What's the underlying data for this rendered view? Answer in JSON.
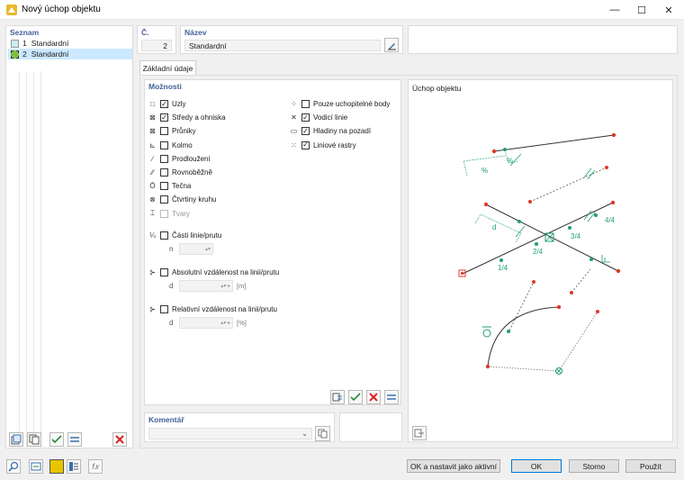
{
  "window": {
    "title": "Nový úchop objektu",
    "minimize": "—",
    "maximize": "☐",
    "close": "✕"
  },
  "list": {
    "title": "Seznam",
    "items": [
      {
        "num": "1",
        "label": "Standardní",
        "color": "#c8ecf0"
      },
      {
        "num": "2",
        "label": "Standardní",
        "color": "#7fbf3f"
      }
    ]
  },
  "number": {
    "label": "Č.",
    "value": "2"
  },
  "name": {
    "label": "Název",
    "value": "Standardní"
  },
  "tabs": [
    "Základní údaje"
  ],
  "options": {
    "title": "Možnosti",
    "left": [
      {
        "label": "Uzly",
        "checked": true,
        "icon": "□"
      },
      {
        "label": "Středy a ohniska",
        "checked": true,
        "icon": "⊠"
      },
      {
        "label": "Průniky",
        "checked": false,
        "icon": "⊠"
      },
      {
        "label": "Kolmo",
        "checked": false,
        "icon": "⊾"
      },
      {
        "label": "Prodloužení",
        "checked": false,
        "icon": "∕"
      },
      {
        "label": "Rovnoběžně",
        "checked": false,
        "icon": "∕∕"
      },
      {
        "label": "Tečna",
        "checked": false,
        "icon": "Ō"
      },
      {
        "label": "Čtvrtiny kruhu",
        "checked": false,
        "icon": "⊗"
      },
      {
        "label": "Tvary",
        "checked": false,
        "icon": "⌶",
        "disabled": true
      }
    ],
    "right": [
      {
        "label": "Pouze uchopitelné body",
        "checked": false,
        "icon": "⁘"
      },
      {
        "label": "Vodicí linie",
        "checked": true,
        "icon": "✕"
      },
      {
        "label": "Hladiny na pozadí",
        "checked": true,
        "icon": "▭"
      },
      {
        "label": "Liniové rastry",
        "checked": true,
        "icon": "⁙"
      }
    ],
    "parts": {
      "label": "Části linie/prutu",
      "checked": false,
      "icon": "¼",
      "field_label": "n"
    },
    "absolute": {
      "label": "Absolutní vzdálenost na linii/prutu",
      "checked": false,
      "icon": "⊱",
      "field_label": "d",
      "unit": "[m]"
    },
    "relative": {
      "label": "Relativní vzdálenost na linii/prutu",
      "checked": false,
      "icon": "⊱",
      "field_label": "d",
      "unit": "[%]"
    }
  },
  "preview": {
    "title": "Úchop objektu",
    "labels": {
      "percent_a": "%",
      "percent_b": "%",
      "d": "d",
      "quarter_14": "1/4",
      "quarter_24": "2/4",
      "quarter_34": "3/4",
      "quarter_44": "4/4"
    }
  },
  "comment": {
    "label": "Komentář",
    "value": ""
  },
  "buttons": {
    "ok_active": "OK a nastavit jako aktivní",
    "ok": "OK",
    "cancel": "Storno",
    "apply": "Použít"
  },
  "colors": {
    "accent": "#44619a",
    "snap_green": "#1f9e6e",
    "endpoint_red": "#e0392b",
    "selection": "#cce8ff"
  }
}
